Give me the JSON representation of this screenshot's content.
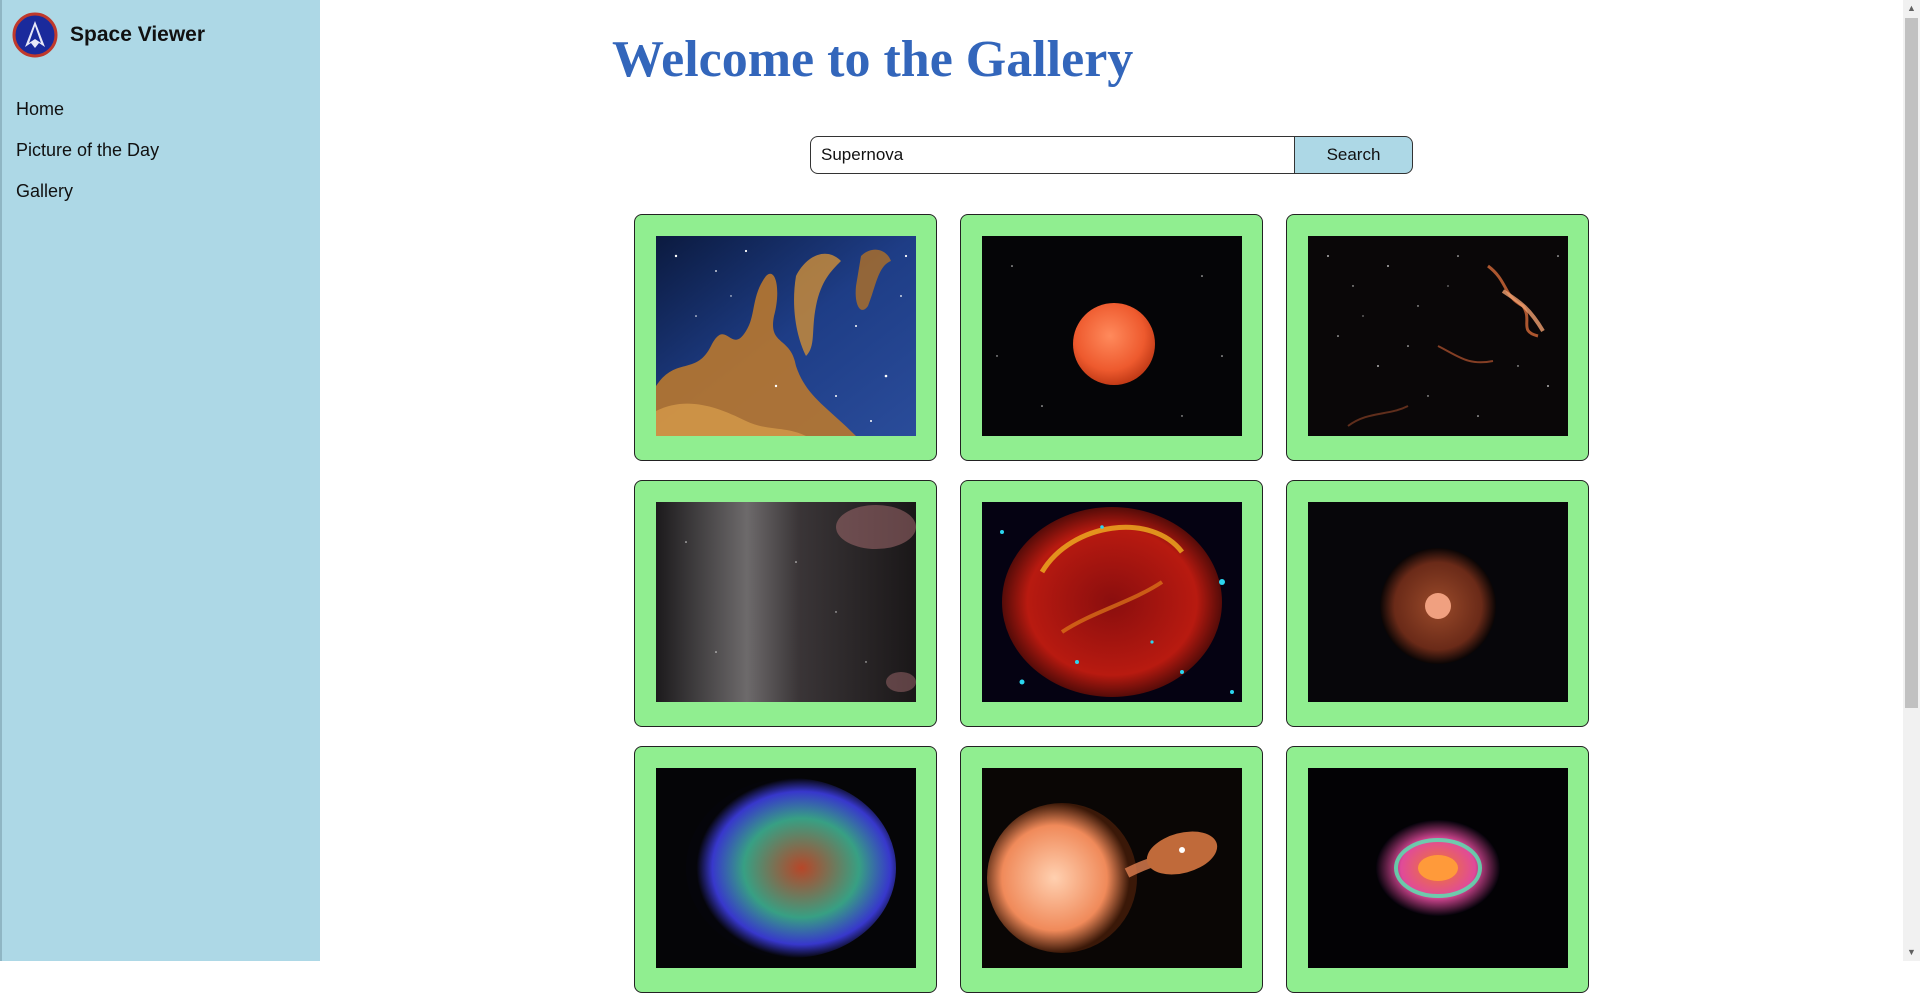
{
  "app": {
    "name": "Space Viewer",
    "logo_icon": "rocket-logo-icon"
  },
  "sidebar": {
    "items": [
      {
        "label": "Home"
      },
      {
        "label": "Picture of the Day"
      },
      {
        "label": "Gallery"
      }
    ]
  },
  "main": {
    "title": "Welcome to the Gallery",
    "search": {
      "value": "Supernova",
      "button_label": "Search"
    }
  },
  "gallery": {
    "images": [
      {
        "subject": "nebula-pillars"
      },
      {
        "subject": "red-star"
      },
      {
        "subject": "supernova-remnant-filaments"
      },
      {
        "subject": "grey-dust-cloud"
      },
      {
        "subject": "red-supernova-remnant"
      },
      {
        "subject": "star-with-halo"
      },
      {
        "subject": "multicolor-supernova-remnant"
      },
      {
        "subject": "binary-star-accretion"
      },
      {
        "subject": "ring-supernova"
      }
    ]
  },
  "colors": {
    "sidebar_bg": "#add8e6",
    "title": "#3366bb",
    "card_bg": "#90ee90",
    "search_button_bg": "#add8e6"
  }
}
